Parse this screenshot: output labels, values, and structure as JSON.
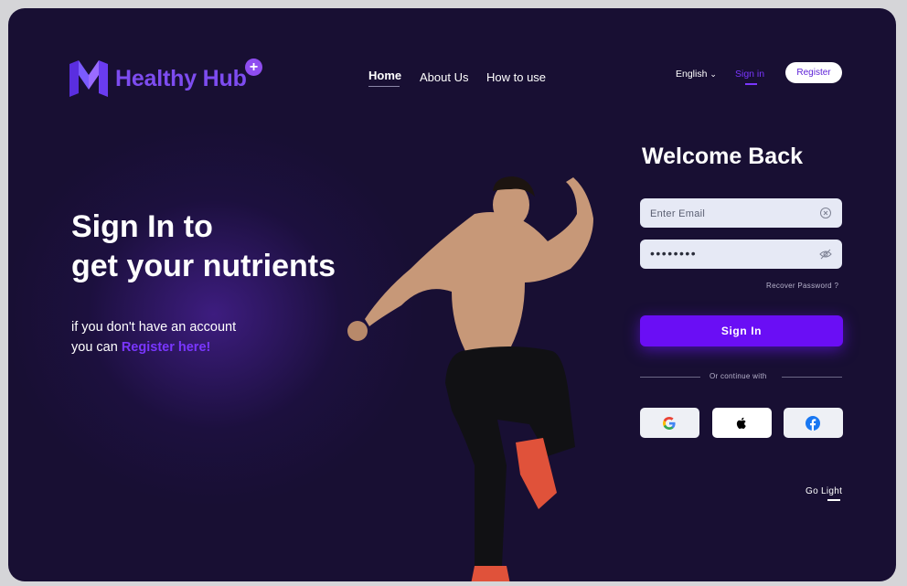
{
  "brand": {
    "name": "Healthy Hub",
    "plus_symbol": "+"
  },
  "nav": {
    "items": [
      {
        "label": "Home",
        "active": true
      },
      {
        "label": "About Us",
        "active": false
      },
      {
        "label": "How to use",
        "active": false
      }
    ]
  },
  "header": {
    "language": "English",
    "language_chevron": "⌄",
    "signin_label": "Sign in",
    "register_label": "Register"
  },
  "hero": {
    "title_line1": "Sign In to",
    "title_line2": "get your nutrients",
    "subtitle_line1": "if you don't have an account",
    "subtitle_prefix": "you can",
    "register_link": "Register here!"
  },
  "form": {
    "heading": "Welcome Back",
    "email_placeholder": "Enter Email",
    "password_mask": "••••••••",
    "recover_label": "Recover Password ?",
    "submit_label": "Sign In",
    "divider_text": "Or continue with",
    "social_icons": [
      "google-icon",
      "apple-icon",
      "facebook-icon"
    ]
  },
  "footer": {
    "theme_toggle_label": "Go Light"
  },
  "colors": {
    "background": "#180f33",
    "accent": "#6a0ef5",
    "link": "#7a36ff",
    "field": "#e6e9f5"
  }
}
